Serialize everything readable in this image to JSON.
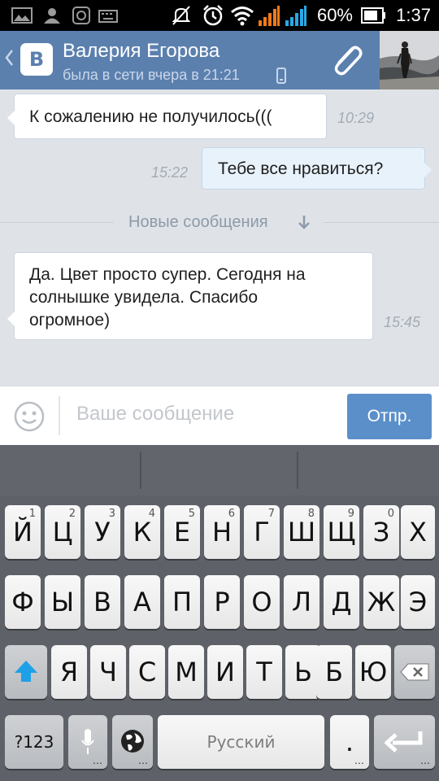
{
  "status_bar": {
    "battery_percent": "60%",
    "time": "1:37",
    "icons": [
      "image-icon",
      "person-icon",
      "camera-icon",
      "keyboard-icon",
      "mute-icon",
      "alarm-icon",
      "wifi-icon",
      "signal-orange-icon",
      "signal-blue-icon",
      "battery-icon"
    ]
  },
  "header": {
    "contact_name": "Валерия Егорова",
    "last_seen": "была в сети вчера в 21:21",
    "app_logo": "В",
    "icons": [
      "chevron-left-icon",
      "phone-icon",
      "paperclip-icon"
    ]
  },
  "messages": [
    {
      "direction": "incoming",
      "text": "К сожалению не получилось(((",
      "time": "10:29"
    },
    {
      "direction": "outgoing",
      "text": "Тебе все нравиться?",
      "time": "15:22"
    },
    {
      "direction": "incoming",
      "text": "Да. Цвет просто супер. Сегодня на солнышке увидела. Спасибо огромное)",
      "lines": [
        "Да. Цвет просто супер. Сегодня на",
        "солнышке увидела. Спасибо",
        "огромное)"
      ],
      "time": "15:45"
    }
  ],
  "divider": {
    "label": "Новые сообщения",
    "icon": "arrow-down-icon"
  },
  "composer": {
    "placeholder": "Ваше сообщение",
    "send_label": "Отпр.",
    "icon": "emoji-icon"
  },
  "keyboard": {
    "row1": [
      {
        "k": "Й",
        "n": "1"
      },
      {
        "k": "Ц",
        "n": "2"
      },
      {
        "k": "У",
        "n": "3"
      },
      {
        "k": "К",
        "n": "4"
      },
      {
        "k": "Е",
        "n": "5"
      },
      {
        "k": "Н",
        "n": "6"
      },
      {
        "k": "Г",
        "n": "7"
      },
      {
        "k": "Ш",
        "n": "8"
      },
      {
        "k": "Щ",
        "n": "9"
      },
      {
        "k": "З",
        "n": "0"
      },
      {
        "k": "Х",
        "n": ""
      }
    ],
    "row2": [
      "Ф",
      "Ы",
      "В",
      "А",
      "П",
      "Р",
      "О",
      "Л",
      "Д",
      "Ж",
      "Э"
    ],
    "row3": [
      "Я",
      "Ч",
      "С",
      "М",
      "И",
      "Т",
      "Ь",
      "Б",
      "Ю"
    ],
    "symbols_label": "?123",
    "space_label": "Русский",
    "period_label": ".",
    "icons": [
      "shift-icon",
      "backspace-icon",
      "mic-icon",
      "globe-icon",
      "enter-icon"
    ]
  }
}
